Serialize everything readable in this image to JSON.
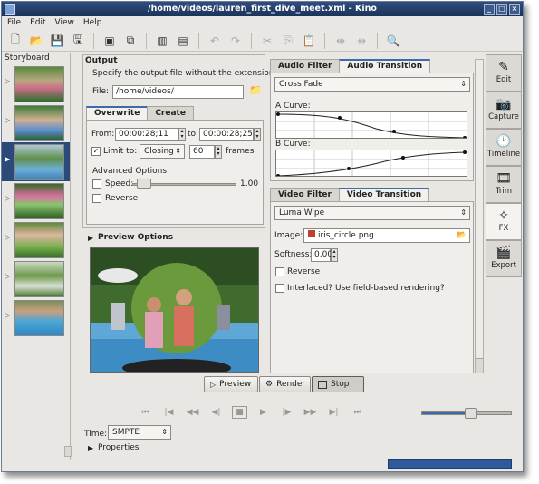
{
  "window": {
    "title": "/home/videos/lauren_first_dive_meet.xml - Kino"
  },
  "menu": [
    "File",
    "Edit",
    "View",
    "Help"
  ],
  "toolbar": {
    "icons": [
      "new-icon",
      "open-icon",
      "save-icon",
      "save-as-icon",
      "capture-icon",
      "export-icon",
      "split-icon",
      "join-icon",
      "undo-icon",
      "redo-icon",
      "cut-icon",
      "copy-icon",
      "paste-icon",
      "scene-left-icon",
      "scene-right-icon",
      "zoom-icon"
    ]
  },
  "storyboard": {
    "title": "Storyboard",
    "selected_index": 2,
    "count": 7
  },
  "output": {
    "title": "Output",
    "hint": "Specify the output file without the extension",
    "file_label": "File:",
    "file_value": "/home/videos/"
  },
  "range_tabs": [
    "Overwrite",
    "Create"
  ],
  "range": {
    "from_label": "From:",
    "from_value": "00:00:28;11",
    "to_label": "to:",
    "to_value": "00:00:28;25",
    "limit_label": "Limit to:",
    "limit_mode": "Closing",
    "limit_frames": "60",
    "frames_label": "frames",
    "advanced_label": "Advanced Options",
    "speed_label": "Speed:",
    "speed_value": "1.00",
    "reverse_label": "Reverse"
  },
  "preview_options": {
    "label": "Preview Options"
  },
  "buttons": {
    "preview": "Preview",
    "render": "Render",
    "stop": "Stop"
  },
  "audio": {
    "tabs": [
      "Audio Filter",
      "Audio Transition"
    ],
    "transition": "Cross Fade",
    "a_curve_label": "A Curve:",
    "b_curve_label": "B Curve:"
  },
  "video": {
    "tabs": [
      "Video Filter",
      "Video Transition"
    ],
    "transition": "Luma Wipe",
    "image_label": "Image:",
    "image_value": "iris_circle.png",
    "softness_label": "Softness:",
    "softness_value": "0.00",
    "reverse_label": "Reverse",
    "interlaced_label": "Interlaced? Use field-based rendering?"
  },
  "side_tabs": [
    {
      "label": "Edit",
      "icon": "edit-icon"
    },
    {
      "label": "Capture",
      "icon": "capture-icon"
    },
    {
      "label": "Timeline",
      "icon": "timeline-icon"
    },
    {
      "label": "Trim",
      "icon": "trim-icon"
    },
    {
      "label": "FX",
      "icon": "fx-icon"
    },
    {
      "label": "Export",
      "icon": "export-icon"
    }
  ],
  "active_side_tab": "FX",
  "bottom": {
    "time_label": "Time:",
    "time_format": "SMPTE",
    "properties_label": "Properties",
    "volume_level": 0.55
  }
}
